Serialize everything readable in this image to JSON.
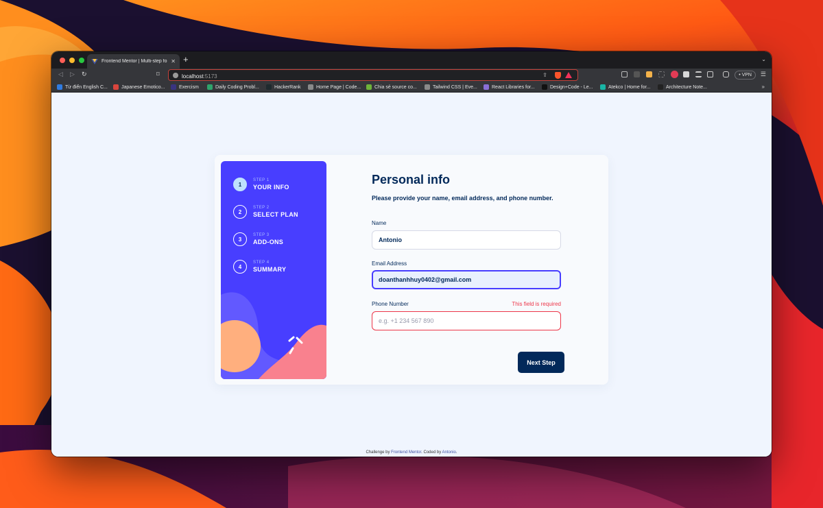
{
  "browser": {
    "tab_title": "Frontend Mentor | Multi-step fo",
    "tab_close": "✕",
    "new_tab": "+",
    "tab_menu": "⌄",
    "url_host": "localhost",
    "url_port": ":5173",
    "vpn_label": "• VPN",
    "menu": "☰",
    "more_bookmarks": "»",
    "bookmarks": [
      {
        "label": "Từ điển English C...",
        "color": "#2f7be0"
      },
      {
        "label": "Japanese Emotico...",
        "color": "#d9453d"
      },
      {
        "label": "Exercism",
        "color": "#3a3480"
      },
      {
        "label": "Daily Coding Probl...",
        "color": "#2fa36b"
      },
      {
        "label": "HackerRank",
        "color": "#1f2a2e"
      },
      {
        "label": "Home Page | Code...",
        "color": "#8a8a8a"
      },
      {
        "label": "Chia sẻ source co...",
        "color": "#6fb33a"
      },
      {
        "label": "Tailwind CSS | Eve...",
        "color": "#8a8a8a"
      },
      {
        "label": "React Libraries for...",
        "color": "#8a6fd6"
      },
      {
        "label": "Design+Code - Le...",
        "color": "#111111"
      },
      {
        "label": "Atekco | Home for...",
        "color": "#19b5a5"
      },
      {
        "label": "Architecture Note...",
        "color": "#222222"
      }
    ]
  },
  "steps": [
    {
      "num": "1",
      "small": "STEP 1",
      "big": "YOUR INFO",
      "active": true
    },
    {
      "num": "2",
      "small": "STEP 2",
      "big": "SELECT PLAN",
      "active": false
    },
    {
      "num": "3",
      "small": "STEP 3",
      "big": "ADD-ONS",
      "active": false
    },
    {
      "num": "4",
      "small": "STEP 4",
      "big": "SUMMARY",
      "active": false
    }
  ],
  "form": {
    "title": "Personal info",
    "subtitle": "Please provide your name, email address, and phone number.",
    "name_label": "Name",
    "name_value": "Antonio",
    "email_label": "Email Address",
    "email_value": "doanthanhhuy0402@gmail.com",
    "phone_label": "Phone Number",
    "phone_error": "This field is required",
    "phone_placeholder": "e.g. +1 234 567 890",
    "next_label": "Next Step"
  },
  "footer": {
    "prefix": "Challenge by ",
    "mentor_link": "Frontend Mentor",
    "middle": ". Coded by ",
    "author_link": "Antonio",
    "suffix": "."
  },
  "colors": {
    "marine_blue": "#02295a",
    "purplish_blue": "#483eff",
    "error_red": "#ed3548",
    "light_blue": "#bee2fd"
  }
}
